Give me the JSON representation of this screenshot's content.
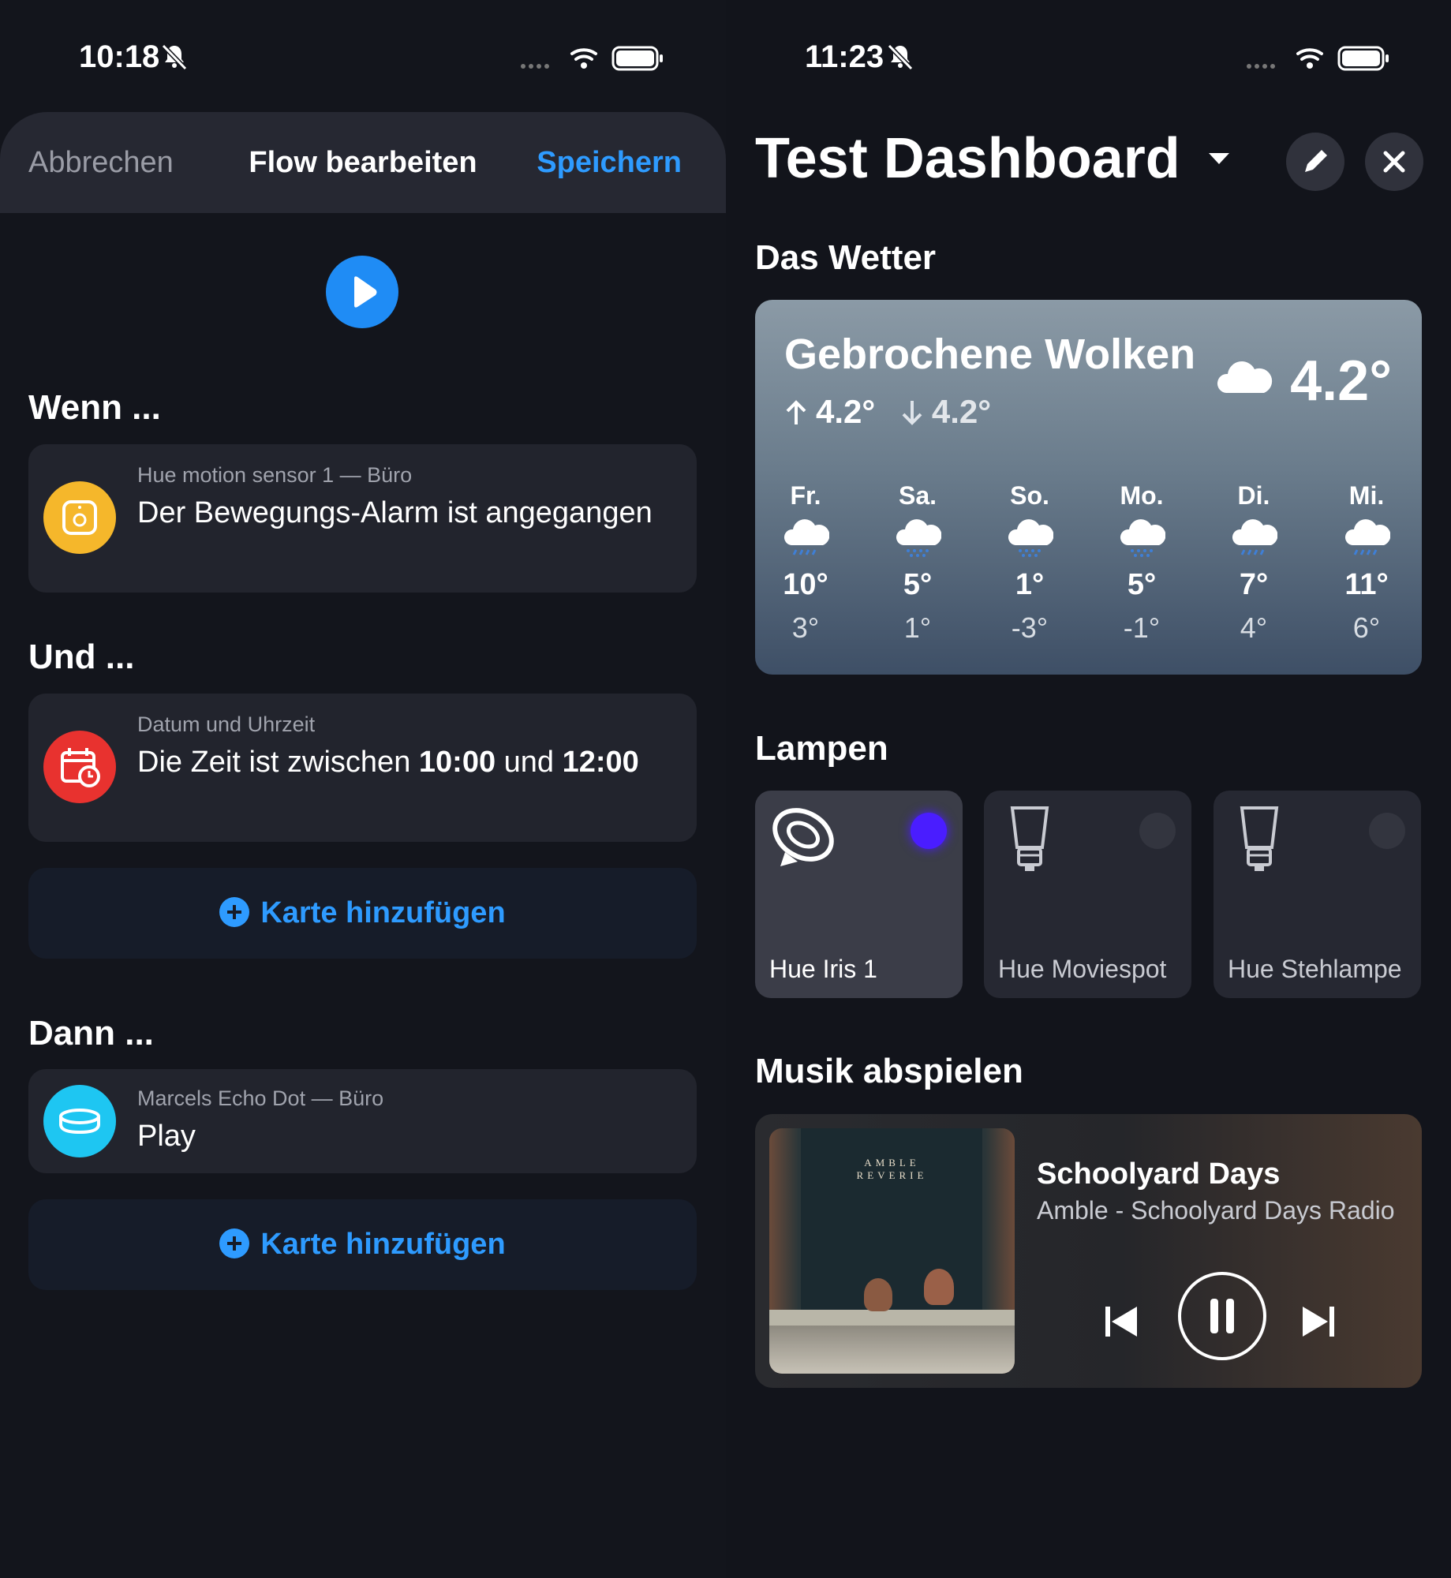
{
  "left": {
    "status": {
      "time": "10:18"
    },
    "topbar": {
      "cancel": "Abbrechen",
      "title": "Flow bearbeiten",
      "save": "Speichern"
    },
    "when": {
      "heading": "Wenn ...",
      "card": {
        "device": "Hue motion sensor 1 — Büro",
        "text": "Der Bewegungs-Alarm ist angegangen"
      }
    },
    "and": {
      "heading": "Und ...",
      "card": {
        "device": "Datum und Uhrzeit",
        "text_a": "Die Zeit ist zwischen ",
        "time_a": "10:00",
        "text_b": " und ",
        "time_b": "12:00"
      },
      "add": "Karte hinzufügen"
    },
    "then": {
      "heading": "Dann ...",
      "card": {
        "device": "Marcels Echo Dot — Büro",
        "text": "Play"
      },
      "add": "Karte hinzufügen"
    }
  },
  "right": {
    "status": {
      "time": "11:23"
    },
    "title": "Test Dashboard",
    "weather": {
      "heading": "Das Wetter",
      "condition": "Gebrochene Wolken",
      "high": "4.2°",
      "low": "4.2°",
      "temp": "4.2°",
      "days": [
        {
          "name": "Fr.",
          "hi": "10°",
          "lo": "3°",
          "icon": "rain-cloud-icon"
        },
        {
          "name": "Sa.",
          "hi": "5°",
          "lo": "1°",
          "icon": "snow-cloud-icon"
        },
        {
          "name": "So.",
          "hi": "1°",
          "lo": "-3°",
          "icon": "snow-cloud-icon"
        },
        {
          "name": "Mo.",
          "hi": "5°",
          "lo": "-1°",
          "icon": "snow-cloud-icon"
        },
        {
          "name": "Di.",
          "hi": "7°",
          "lo": "4°",
          "icon": "rain-cloud-icon"
        },
        {
          "name": "Mi.",
          "hi": "11°",
          "lo": "6°",
          "icon": "rain-cloud-icon"
        }
      ]
    },
    "lamps": {
      "heading": "Lampen",
      "items": [
        {
          "name": "Hue Iris 1",
          "on": true,
          "color": "#4a1dff"
        },
        {
          "name": "Hue Moviespot",
          "on": false
        },
        {
          "name": "Hue Stehlampe",
          "on": false
        }
      ]
    },
    "music": {
      "heading": "Musik abspielen",
      "track": "Schoolyard Days",
      "artist": "Amble - Schoolyard Days Radio",
      "cover_text_1": "AMBLE",
      "cover_text_2": "REVERIE"
    }
  },
  "colors": {
    "accent": "#2e9bff",
    "play_button": "#1f8cf5",
    "motion_icon": "#f5b72b",
    "calendar_icon": "#e8322f",
    "echo_icon": "#1ec6f2"
  }
}
